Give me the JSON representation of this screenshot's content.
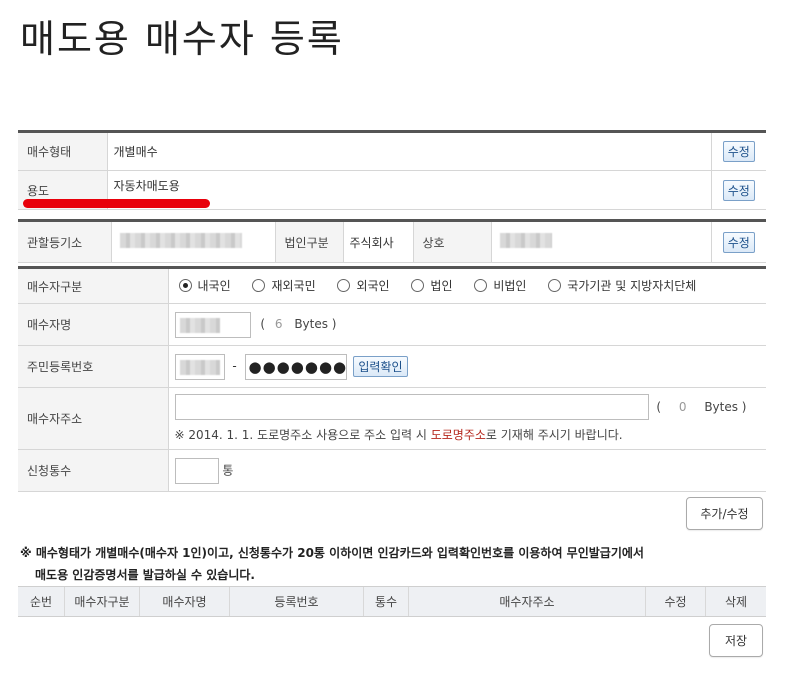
{
  "title": "매도용 매수자 등록",
  "section1": {
    "rows": [
      {
        "label": "매수형태",
        "value": "개별매수",
        "button": "수정"
      },
      {
        "label": "용도",
        "value": "자동차매도용",
        "button": "수정"
      }
    ]
  },
  "section2": {
    "agency_label": "관할등기소",
    "corp_type_label": "법인구분",
    "corp_type_value": "주식회사",
    "trade_name_label": "상호",
    "button": "수정"
  },
  "buyer": {
    "type_label": "매수자구분",
    "type_options": [
      "내국인",
      "재외국민",
      "외국인",
      "법인",
      "비법인",
      "국가기관 및 지방자치단체"
    ],
    "type_selected": "내국인",
    "name_label": "매수자명",
    "name_bytes_open": "(",
    "name_bytes": "6",
    "name_bytes_unit": "Bytes )",
    "id_label": "주민등록번호",
    "id_dash": "-",
    "id_masked": "●●●●●●●",
    "id_confirm_button": "입력확인",
    "address_label": "매수자주소",
    "address_bytes_open": "(",
    "address_bytes": "0",
    "address_bytes_unit": "Bytes )",
    "address_notice_pre": "※ 2014. 1. 1. 도로명주소 사용으로 주소 입력 시 ",
    "address_notice_highlight": "도로명주소",
    "address_notice_post": "로 기재해 주시기 바랍니다.",
    "count_label": "신청통수",
    "count_unit": "통"
  },
  "add_edit_button": "추가/수정",
  "notice": {
    "line1": "※ 매수형태가 개별매수(매수자 1인)이고, 신청통수가 20통 이하이면 인감카드와 입력확인번호를 이용하여 무인발급기에서",
    "line2": "매도용 인감증명서를 발급하실 수 있습니다."
  },
  "grid_columns": [
    "순번",
    "매수자구분",
    "매수자명",
    "등록번호",
    "통수",
    "매수자주소",
    "수정",
    "삭제"
  ],
  "save_button": "저장",
  "colors": {
    "highlight": "#b5271d",
    "annotation": "#e8000b"
  }
}
